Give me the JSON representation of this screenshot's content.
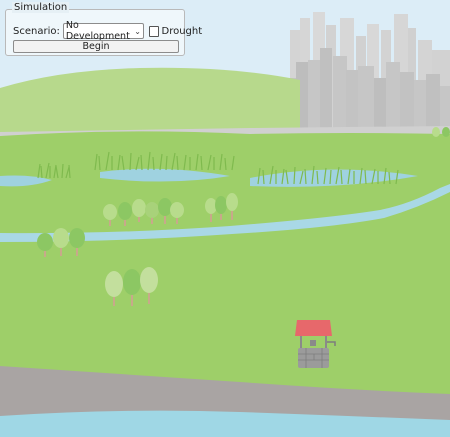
{
  "panel": {
    "legend": "Simulation",
    "scenario_label": "Scenario:",
    "scenario_value": "No Development",
    "drought_label": "Drought",
    "drought_checked": false,
    "begin_label": "Begin"
  },
  "colors": {
    "sky": "#dcedf7",
    "grass": "#9fcf6a",
    "hill": "#b5d88a",
    "water": "#a8d7e4",
    "rock": "#a8a4a3",
    "city": "#c8c8c8",
    "well_roof": "#e6686b"
  }
}
